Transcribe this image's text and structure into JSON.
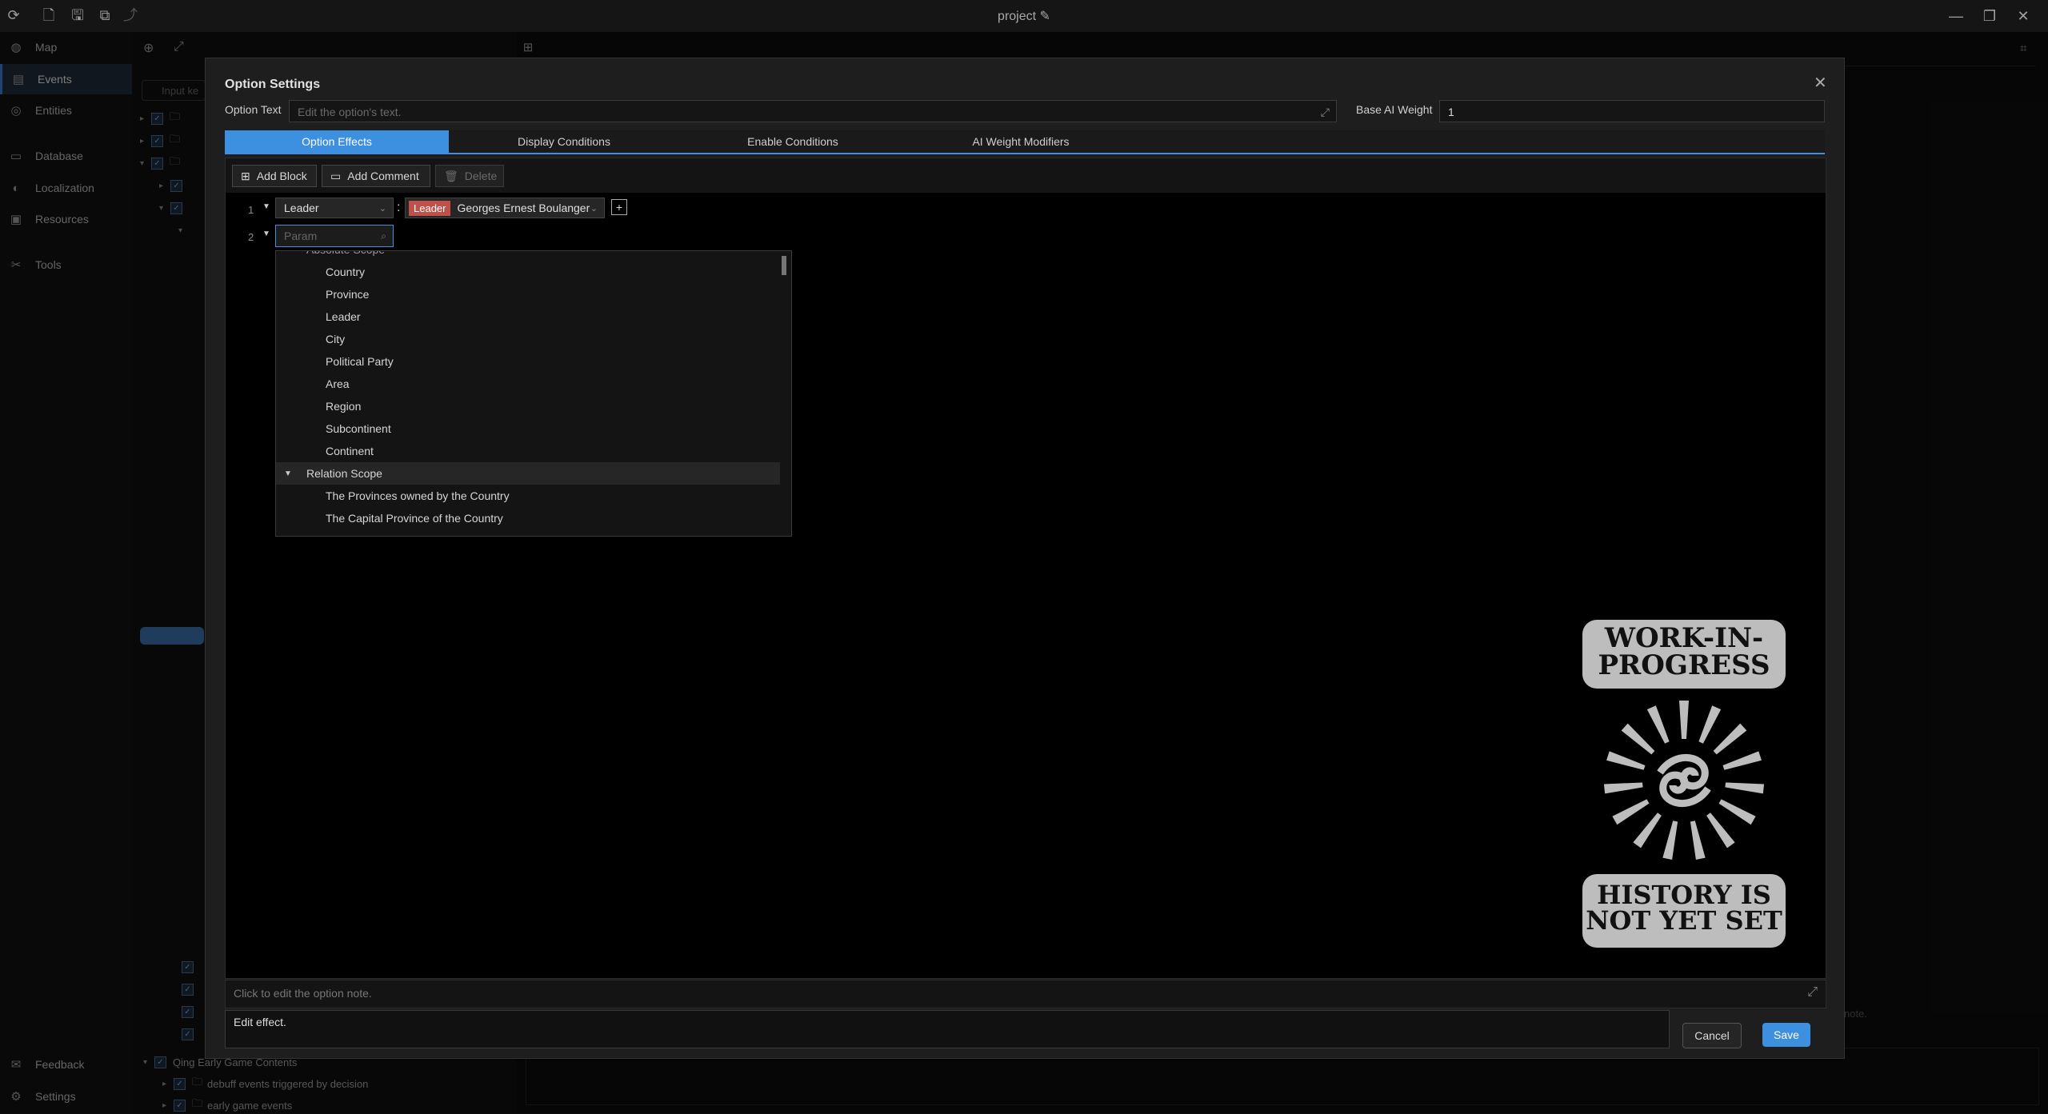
{
  "app": {
    "title": "project"
  },
  "nav": {
    "items": [
      {
        "label": "Map",
        "icon": "globe-icon"
      },
      {
        "label": "Events",
        "icon": "calendar-icon"
      },
      {
        "label": "Entities",
        "icon": "layers-icon"
      },
      {
        "label": "Database",
        "icon": "database-icon"
      },
      {
        "label": "Localization",
        "icon": "translate-icon"
      },
      {
        "label": "Resources",
        "icon": "box-icon"
      },
      {
        "label": "Tools",
        "icon": "tools-icon"
      }
    ],
    "bottom": [
      {
        "label": "Feedback",
        "icon": "mail-icon"
      },
      {
        "label": "Settings",
        "icon": "gear-icon"
      }
    ]
  },
  "tree": {
    "search_placeholder": "Input ke",
    "bottom_rows": [
      {
        "label": "Qing Early Game Contents"
      },
      {
        "label": "debuff events triggered by decision"
      },
      {
        "label": "early game events"
      }
    ]
  },
  "background": {
    "right_note_placeholder": "note."
  },
  "dialog": {
    "title": "Option Settings",
    "option_text_label": "Option Text",
    "option_text_placeholder": "Edit the option's text.",
    "ai_weight_label": "Base AI Weight",
    "ai_weight_value": "1",
    "tabs": [
      {
        "label": "Option Effects",
        "active": true
      },
      {
        "label": "Display Conditions",
        "active": false
      },
      {
        "label": "Enable Conditions",
        "active": false
      },
      {
        "label": "AI Weight Modifiers",
        "active": false
      }
    ],
    "toolbar": {
      "add_block": "Add Block",
      "add_comment": "Add Comment",
      "delete": "Delete"
    },
    "lines": [
      {
        "num": "1",
        "scope": "Leader",
        "badge": "Leader",
        "value": "Georges Ernest Boulanger"
      },
      {
        "num": "2",
        "param_placeholder": "Param"
      }
    ],
    "dropdown": {
      "partial_group": "Absolute Scope",
      "items": [
        "Country",
        "Province",
        "Leader",
        "City",
        "Political Party",
        "Area",
        "Region",
        "Subcontinent",
        "Continent"
      ],
      "group2": "Relation Scope",
      "items2": [
        "The Provinces owned by the Country",
        "The Capital Province of the Country"
      ]
    },
    "wip": {
      "top": "WORK-IN-PROGRESS",
      "bottom": "HISTORY IS NOT YET SET"
    },
    "note_placeholder": "Click to edit the option note.",
    "status_text": "Edit effect.",
    "cancel": "Cancel",
    "save": "Save"
  },
  "colors": {
    "accent": "#3d8fe0",
    "badge": "#c0504a"
  }
}
